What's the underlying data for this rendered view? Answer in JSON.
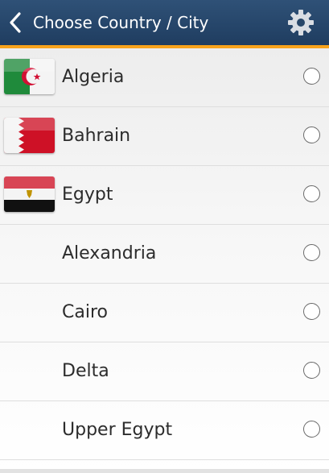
{
  "header": {
    "title": "Choose Country / City",
    "back_icon": "chevron-left-icon",
    "settings_icon": "gear-icon",
    "accent_color": "#f7a21b",
    "background_color": "#2a4a70"
  },
  "list": {
    "items": [
      {
        "label": "Algeria",
        "flag": "algeria-flag-icon",
        "selected": false
      },
      {
        "label": "Bahrain",
        "flag": "bahrain-flag-icon",
        "selected": false
      },
      {
        "label": "Egypt",
        "flag": "egypt-flag-icon",
        "selected": false
      },
      {
        "label": "Alexandria",
        "flag": "",
        "selected": false
      },
      {
        "label": "Cairo",
        "flag": "",
        "selected": false
      },
      {
        "label": "Delta",
        "flag": "",
        "selected": false
      },
      {
        "label": "Upper Egypt",
        "flag": "",
        "selected": false
      }
    ]
  }
}
